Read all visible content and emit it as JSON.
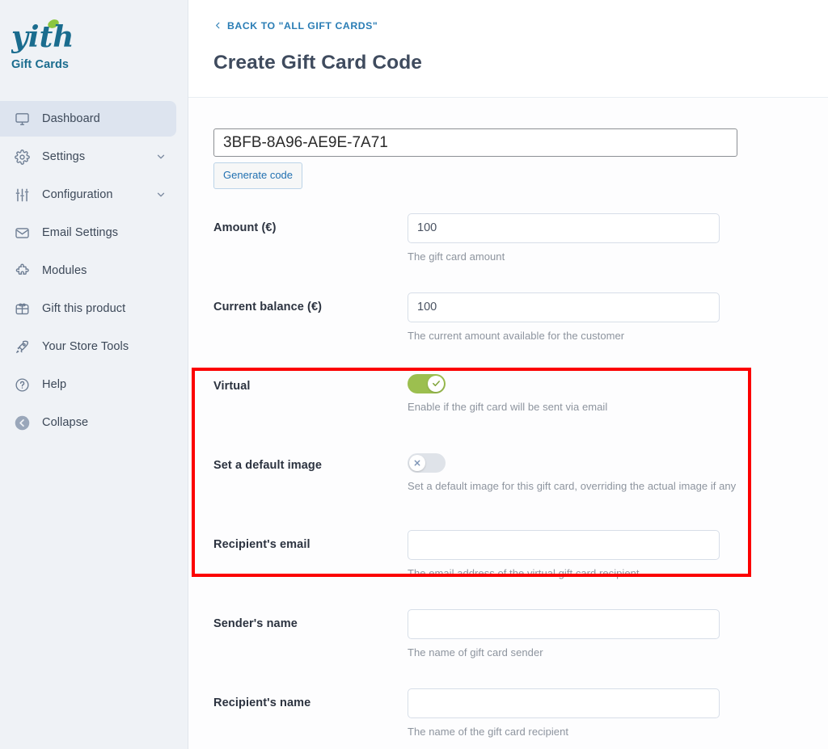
{
  "brand": {
    "logo_text": "yith",
    "subtitle": "Gift Cards"
  },
  "sidebar": {
    "items": [
      {
        "label": "Dashboard",
        "icon": "monitor-icon",
        "active": true,
        "expandable": false
      },
      {
        "label": "Settings",
        "icon": "gear-icon",
        "active": false,
        "expandable": true
      },
      {
        "label": "Configuration",
        "icon": "sliders-icon",
        "active": false,
        "expandable": true
      },
      {
        "label": "Email Settings",
        "icon": "envelope-icon",
        "active": false,
        "expandable": false
      },
      {
        "label": "Modules",
        "icon": "puzzle-icon",
        "active": false,
        "expandable": false
      },
      {
        "label": "Gift this product",
        "icon": "gift-icon",
        "active": false,
        "expandable": false
      },
      {
        "label": "Your Store Tools",
        "icon": "rocket-icon",
        "active": false,
        "expandable": false
      },
      {
        "label": "Help",
        "icon": "question-circle-icon",
        "active": false,
        "expandable": false
      },
      {
        "label": "Collapse",
        "icon": "arrow-left-circle-icon",
        "active": false,
        "expandable": false
      }
    ]
  },
  "header": {
    "back_label": "BACK TO \"ALL GIFT CARDS\"",
    "title": "Create Gift Card Code"
  },
  "form": {
    "code": {
      "value": "3BFB-8A96-AE9E-7A71",
      "generate_label": "Generate code"
    },
    "fields": [
      {
        "label": "Amount (€)",
        "type": "text",
        "value": "100",
        "placeholder": "",
        "help": "The gift card amount"
      },
      {
        "label": "Current balance (€)",
        "type": "text",
        "value": "100",
        "placeholder": "",
        "help": "The current amount available for the customer"
      },
      {
        "label": "Virtual",
        "type": "toggle",
        "state": "on",
        "help": "Enable if the gift card will be sent via email"
      },
      {
        "label": "Set a default image",
        "type": "toggle",
        "state": "off",
        "help": "Set a default image for this gift card, overriding the actual image if any"
      },
      {
        "label": "Recipient's email",
        "type": "text",
        "value": "",
        "placeholder": "",
        "help": "The email address of the virtual gift card recipient"
      },
      {
        "label": "Sender's name",
        "type": "text",
        "value": "",
        "placeholder": "",
        "help": "The name of gift card sender"
      },
      {
        "label": "Recipient's name",
        "type": "text",
        "value": "",
        "placeholder": "",
        "help": "The name of the gift card recipient"
      }
    ]
  },
  "annotation": {
    "highlight_color": "#fc0000"
  },
  "colors": {
    "brand_teal": "#1a6c8e",
    "accent_green": "#9cbf4f",
    "link_blue": "#2a7db5",
    "sidebar_bg": "#eff2f6",
    "active_item_bg": "#dde4ef"
  }
}
